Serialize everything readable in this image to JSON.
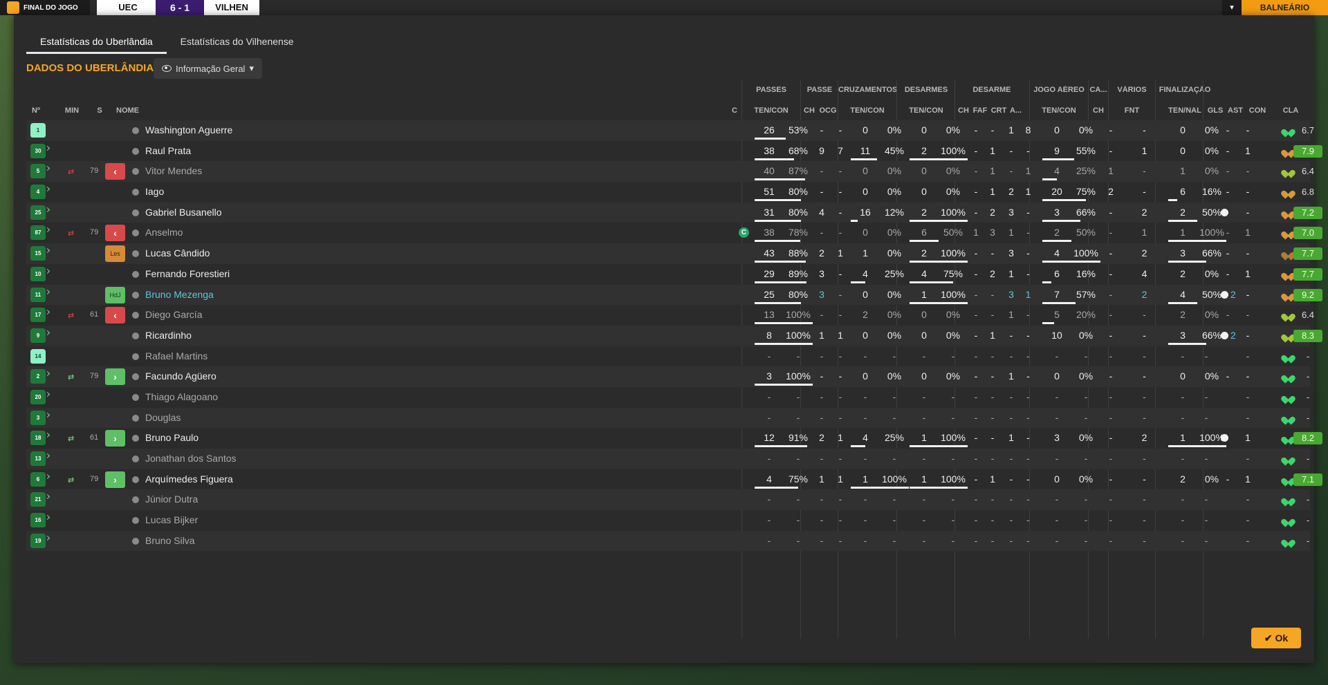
{
  "topbar": {
    "final_label": "FINAL DO JOGO",
    "home": "UEC",
    "score": "6 - 1",
    "away": "VILHEN",
    "balneario": "BALNEÁRIO"
  },
  "tabs": [
    {
      "label": "Estatísticas do Uberlândia"
    },
    {
      "label": "Estatísticas do Vilhenense"
    }
  ],
  "section_title": "DADOS DO UBERLÂNDIA",
  "dropdown": {
    "label": "Informação Geral"
  },
  "groups": [
    "PASSES",
    "PASSE",
    "CRUZAMENTOS",
    "DESARMES",
    "DESARME",
    "JOGO AÉREO",
    "CA...",
    "VÁRIOS",
    "FINALIZAÇÃO"
  ],
  "columns": [
    "Nº",
    "MIN",
    "S",
    "NOME",
    "C",
    "TEN/CON",
    "CH",
    "OCG",
    "TEN/CON",
    "TEN/CON",
    "CH",
    "FAF",
    "CRT",
    "A...",
    "TEN/CON",
    "CH",
    "FNT",
    "TEN/NAL",
    "GLS",
    "AST",
    "CON",
    "CLA"
  ],
  "colors": {
    "accent": "#f5a623",
    "highlight": "#5fc5dc",
    "rating_good": "#49a832",
    "sub_out": "#d84a4a",
    "sub_in": "#5fbf67"
  },
  "players": [
    {
      "num": "1",
      "gk": true,
      "name": "Washington Aguerre",
      "pass": [
        "26",
        "53%"
      ],
      "pbar": 0.53,
      "ch": "-",
      "ocg": "-",
      "cross": [
        "0",
        "0%"
      ],
      "xbar": 0,
      "tack": [
        "0",
        "0%"
      ],
      "tbar": 0,
      "dch": "-",
      "faf": "-",
      "crt": "1",
      "a": "8",
      "air": [
        "0",
        "0%"
      ],
      "abar": 0,
      "ca": "-",
      "fnt": "-",
      "shot": [
        "0",
        "0%"
      ],
      "sbar": 0,
      "gls": "",
      "ast": "-",
      "heart": "#3dd66a",
      "cla": "6.7",
      "good": false
    },
    {
      "num": "30",
      "name": "Raul Prata",
      "pass": [
        "38",
        "68%"
      ],
      "pbar": 0.68,
      "ch": "9",
      "ocg": "7",
      "cross": [
        "11",
        "45%"
      ],
      "xbar": 0.45,
      "tack": [
        "2",
        "100%"
      ],
      "tbar": 1,
      "dch": "-",
      "faf": "1",
      "crt": "-",
      "a": "-",
      "air": [
        "9",
        "55%"
      ],
      "abar": 0.55,
      "ca": "-",
      "fnt": "1",
      "shot": [
        "0",
        "0%"
      ],
      "sbar": 0,
      "gls": "",
      "ast": "1",
      "heart": "#d69a3a",
      "cla": "7.9",
      "good": true
    },
    {
      "num": "5",
      "dim": true,
      "sub": "out",
      "min": "79",
      "s": "out",
      "name": "Vitor Mendes",
      "pass": [
        "40",
        "87%"
      ],
      "pbar": 0.87,
      "ch": "-",
      "ocg": "-",
      "cross": [
        "0",
        "0%"
      ],
      "xbar": 0,
      "tack": [
        "0",
        "0%"
      ],
      "tbar": 0,
      "dch": "-",
      "faf": "1",
      "crt": "-",
      "a": "1",
      "air": [
        "4",
        "25%"
      ],
      "abar": 0.25,
      "ca": "1",
      "fnt": "-",
      "shot": [
        "1",
        "0%"
      ],
      "sbar": 0,
      "gls": "",
      "ast": "-",
      "heart": "#a0c83a",
      "cla": "6.4",
      "good": false
    },
    {
      "num": "4",
      "name": "Iago",
      "pass": [
        "51",
        "80%"
      ],
      "pbar": 0.8,
      "ch": "-",
      "ocg": "-",
      "cross": [
        "0",
        "0%"
      ],
      "xbar": 0,
      "tack": [
        "0",
        "0%"
      ],
      "tbar": 0,
      "dch": "-",
      "faf": "1",
      "crt": "2",
      "a": "1",
      "air": [
        "20",
        "75%"
      ],
      "abar": 0.75,
      "ca": "2",
      "fnt": "-",
      "shot": [
        "6",
        "16%"
      ],
      "sbar": 0.16,
      "gls": "",
      "ast": "-",
      "heart": "#d69a3a",
      "cla": "6.8",
      "good": false
    },
    {
      "num": "25",
      "name": "Gabriel Busanello",
      "pass": [
        "31",
        "80%"
      ],
      "pbar": 0.8,
      "ch": "4",
      "ocg": "-",
      "cross": [
        "16",
        "12%"
      ],
      "xbar": 0.12,
      "tack": [
        "2",
        "100%"
      ],
      "tbar": 1,
      "dch": "-",
      "faf": "2",
      "crt": "3",
      "a": "-",
      "air": [
        "3",
        "66%"
      ],
      "abar": 0.66,
      "ca": "-",
      "fnt": "2",
      "shot": [
        "2",
        "50%"
      ],
      "sbar": 0.5,
      "gls": "ball",
      "ast": "-",
      "heart": "#d69a3a",
      "cla": "7.2",
      "good": true
    },
    {
      "num": "87",
      "dim": true,
      "captain": true,
      "sub": "out",
      "min": "79",
      "s": "out",
      "name": "Anselmo",
      "pass": [
        "38",
        "78%"
      ],
      "pbar": 0.78,
      "ch": "-",
      "ocg": "-",
      "cross": [
        "0",
        "0%"
      ],
      "xbar": 0,
      "tack": [
        "6",
        "50%"
      ],
      "tbar": 0.5,
      "dch": "1",
      "faf": "3",
      "crt": "1",
      "a": "-",
      "air": [
        "2",
        "50%"
      ],
      "abar": 0.5,
      "ca": "-",
      "fnt": "1",
      "shot": [
        "1",
        "100%"
      ],
      "sbar": 1,
      "gls": "",
      "ast": "1",
      "heart": "#d69a3a",
      "cla": "7.0",
      "good": true
    },
    {
      "num": "15",
      "s": "les",
      "name": "Lucas Cândido",
      "pass": [
        "43",
        "88%"
      ],
      "pbar": 0.88,
      "ch": "2",
      "ocg": "1",
      "cross": [
        "1",
        "0%"
      ],
      "xbar": 0,
      "tack": [
        "2",
        "100%"
      ],
      "tbar": 1,
      "dch": "-",
      "faf": "-",
      "crt": "3",
      "a": "-",
      "air": [
        "4",
        "100%"
      ],
      "abar": 1,
      "ca": "-",
      "fnt": "2",
      "shot": [
        "3",
        "66%"
      ],
      "sbar": 0.66,
      "gls": "",
      "ast": "-",
      "heart": "#b07a3a",
      "cla": "7.7",
      "good": true
    },
    {
      "num": "10",
      "name": "Fernando Forestieri",
      "pass": [
        "29",
        "89%"
      ],
      "pbar": 0.89,
      "ch": "3",
      "ocg": "-",
      "cross": [
        "4",
        "25%"
      ],
      "xbar": 0.25,
      "tack": [
        "4",
        "75%"
      ],
      "tbar": 0.75,
      "dch": "-",
      "faf": "2",
      "crt": "1",
      "a": "-",
      "air": [
        "6",
        "16%"
      ],
      "abar": 0.16,
      "ca": "-",
      "fnt": "4",
      "shot": [
        "2",
        "0%"
      ],
      "sbar": 0,
      "gls": "",
      "ast": "1",
      "heart": "#d69a3a",
      "cla": "7.7",
      "good": true
    },
    {
      "num": "11",
      "hl": true,
      "s": "hdj",
      "name": "Bruno Mezenga",
      "pass": [
        "25",
        "80%"
      ],
      "pbar": 0.8,
      "ch": "3",
      "ocg": "-",
      "cross": [
        "0",
        "0%"
      ],
      "xbar": 0,
      "tack": [
        "1",
        "100%"
      ],
      "tbar": 1,
      "dch": "-",
      "faf": "-",
      "crt": "3",
      "a": "1",
      "air": [
        "7",
        "57%"
      ],
      "abar": 0.57,
      "ca": "-",
      "fnt": "2",
      "shot": [
        "4",
        "50%"
      ],
      "sbar": 0.5,
      "gls": "2",
      "ast": "-",
      "heart": "#d69a3a",
      "cla": "9.2",
      "good": true
    },
    {
      "num": "17",
      "dim": true,
      "sub": "out",
      "min": "61",
      "s": "out",
      "name": "Diego García",
      "pass": [
        "13",
        "100%"
      ],
      "pbar": 1,
      "ch": "-",
      "ocg": "-",
      "cross": [
        "2",
        "0%"
      ],
      "xbar": 0,
      "tack": [
        "0",
        "0%"
      ],
      "tbar": 0,
      "dch": "-",
      "faf": "-",
      "crt": "1",
      "a": "-",
      "air": [
        "5",
        "20%"
      ],
      "abar": 0.2,
      "ca": "-",
      "fnt": "-",
      "shot": [
        "2",
        "0%"
      ],
      "sbar": 0,
      "gls": "",
      "ast": "-",
      "heart": "#a0c83a",
      "cla": "6.4",
      "good": false
    },
    {
      "num": "9",
      "name": "Ricardinho",
      "pass": [
        "8",
        "100%"
      ],
      "pbar": 1,
      "ch": "1",
      "ocg": "1",
      "cross": [
        "0",
        "0%"
      ],
      "xbar": 0,
      "tack": [
        "0",
        "0%"
      ],
      "tbar": 0,
      "dch": "-",
      "faf": "1",
      "crt": "-",
      "a": "-",
      "air": [
        "10",
        "0%"
      ],
      "abar": 0,
      "ca": "-",
      "fnt": "-",
      "shot": [
        "3",
        "66%"
      ],
      "sbar": 0.66,
      "gls": "2",
      "ast": "-",
      "heart": "#a0c83a",
      "cla": "8.3",
      "good": true
    },
    {
      "num": "14",
      "gk": true,
      "dim": true,
      "name": "Rafael Martins",
      "empty": true,
      "heart": "#3dd66a",
      "cla": "-",
      "good": false
    },
    {
      "num": "2",
      "sub": "in",
      "min": "79",
      "s": "in",
      "name": "Facundo Agüero",
      "pass": [
        "3",
        "100%"
      ],
      "pbar": 1,
      "ch": "-",
      "ocg": "-",
      "cross": [
        "0",
        "0%"
      ],
      "xbar": 0,
      "tack": [
        "0",
        "0%"
      ],
      "tbar": 0,
      "dch": "-",
      "faf": "-",
      "crt": "1",
      "a": "-",
      "air": [
        "0",
        "0%"
      ],
      "abar": 0,
      "ca": "-",
      "fnt": "-",
      "shot": [
        "0",
        "0%"
      ],
      "sbar": 0,
      "gls": "",
      "ast": "-",
      "heart": "#3dd66a",
      "cla": "-",
      "good": false
    },
    {
      "num": "20",
      "dim": true,
      "name": "Thiago Alagoano",
      "empty": true,
      "heart": "#3dd66a",
      "cla": "-",
      "good": false
    },
    {
      "num": "3",
      "dim": true,
      "name": "Douglas",
      "empty": true,
      "heart": "#3dd66a",
      "cla": "-",
      "good": false
    },
    {
      "num": "18",
      "sub": "in",
      "min": "61",
      "s": "in",
      "name": "Bruno Paulo",
      "pass": [
        "12",
        "91%"
      ],
      "pbar": 0.91,
      "ch": "2",
      "ocg": "1",
      "cross": [
        "4",
        "25%"
      ],
      "xbar": 0.25,
      "tack": [
        "1",
        "100%"
      ],
      "tbar": 1,
      "dch": "-",
      "faf": "-",
      "crt": "1",
      "a": "-",
      "air": [
        "3",
        "0%"
      ],
      "abar": 0,
      "ca": "-",
      "fnt": "2",
      "shot": [
        "1",
        "100%"
      ],
      "sbar": 1,
      "gls": "ball",
      "ast": "1",
      "heart": "#3dd66a",
      "cla": "8.2",
      "good": true
    },
    {
      "num": "13",
      "dim": true,
      "name": "Jonathan dos Santos",
      "empty": true,
      "heart": "#3dd66a",
      "cla": "-",
      "good": false
    },
    {
      "num": "6",
      "sub": "in",
      "min": "79",
      "s": "in",
      "name": "Arquímedes Figuera",
      "pass": [
        "4",
        "75%"
      ],
      "pbar": 0.75,
      "ch": "1",
      "ocg": "1",
      "cross": [
        "1",
        "100%"
      ],
      "xbar": 1,
      "tack": [
        "1",
        "100%"
      ],
      "tbar": 1,
      "dch": "-",
      "faf": "1",
      "crt": "-",
      "a": "-",
      "air": [
        "0",
        "0%"
      ],
      "abar": 0,
      "ca": "-",
      "fnt": "-",
      "shot": [
        "2",
        "0%"
      ],
      "sbar": 0,
      "gls": "",
      "ast": "1",
      "heart": "#3dd66a",
      "cla": "7.1",
      "good": true
    },
    {
      "num": "21",
      "dim": true,
      "name": "Júnior Dutra",
      "empty": true,
      "heart": "#3dd66a",
      "cla": "-",
      "good": false
    },
    {
      "num": "16",
      "dim": true,
      "name": "Lucas Bijker",
      "empty": true,
      "heart": "#3dd66a",
      "cla": "-",
      "good": false
    },
    {
      "num": "19",
      "dim": true,
      "name": "Bruno Silva",
      "empty": true,
      "heart": "#3dd66a",
      "cla": "-",
      "good": false
    }
  ],
  "ok_button": {
    "label": "Ok"
  }
}
